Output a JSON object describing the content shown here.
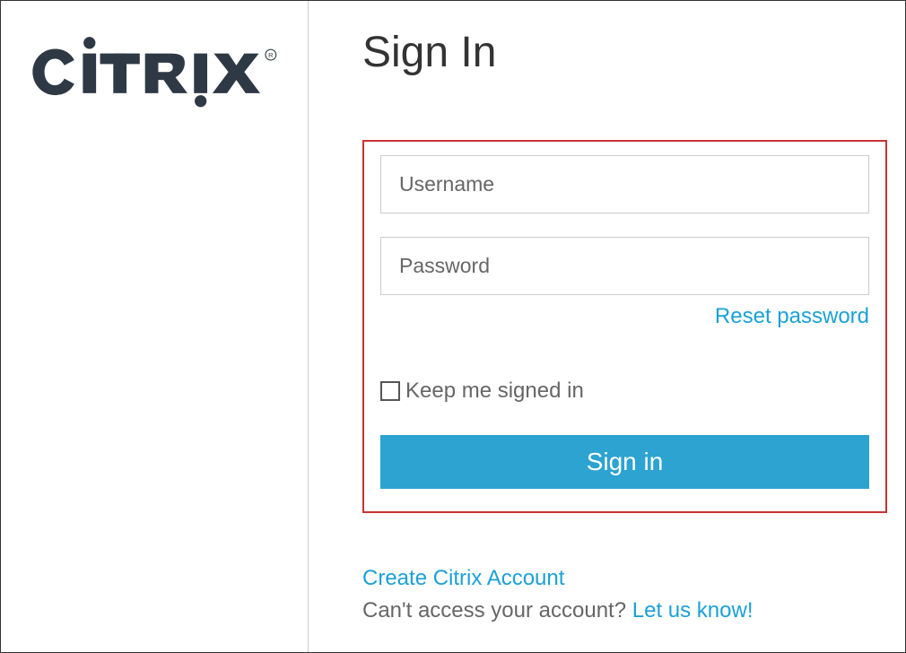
{
  "brand": "CITRIX",
  "header": {
    "title": "Sign In"
  },
  "form": {
    "username_placeholder": "Username",
    "password_placeholder": "Password",
    "reset_password_label": "Reset password",
    "keep_signed_in_label": "Keep me signed in",
    "signin_button_label": "Sign in"
  },
  "footer": {
    "create_account_label": "Create Citrix Account",
    "help_text": "Can't access your account? ",
    "help_link_label": "Let us know!"
  },
  "colors": {
    "accent": "#2ca3d1",
    "link": "#1ba1d6",
    "highlight_border": "#c83232"
  }
}
